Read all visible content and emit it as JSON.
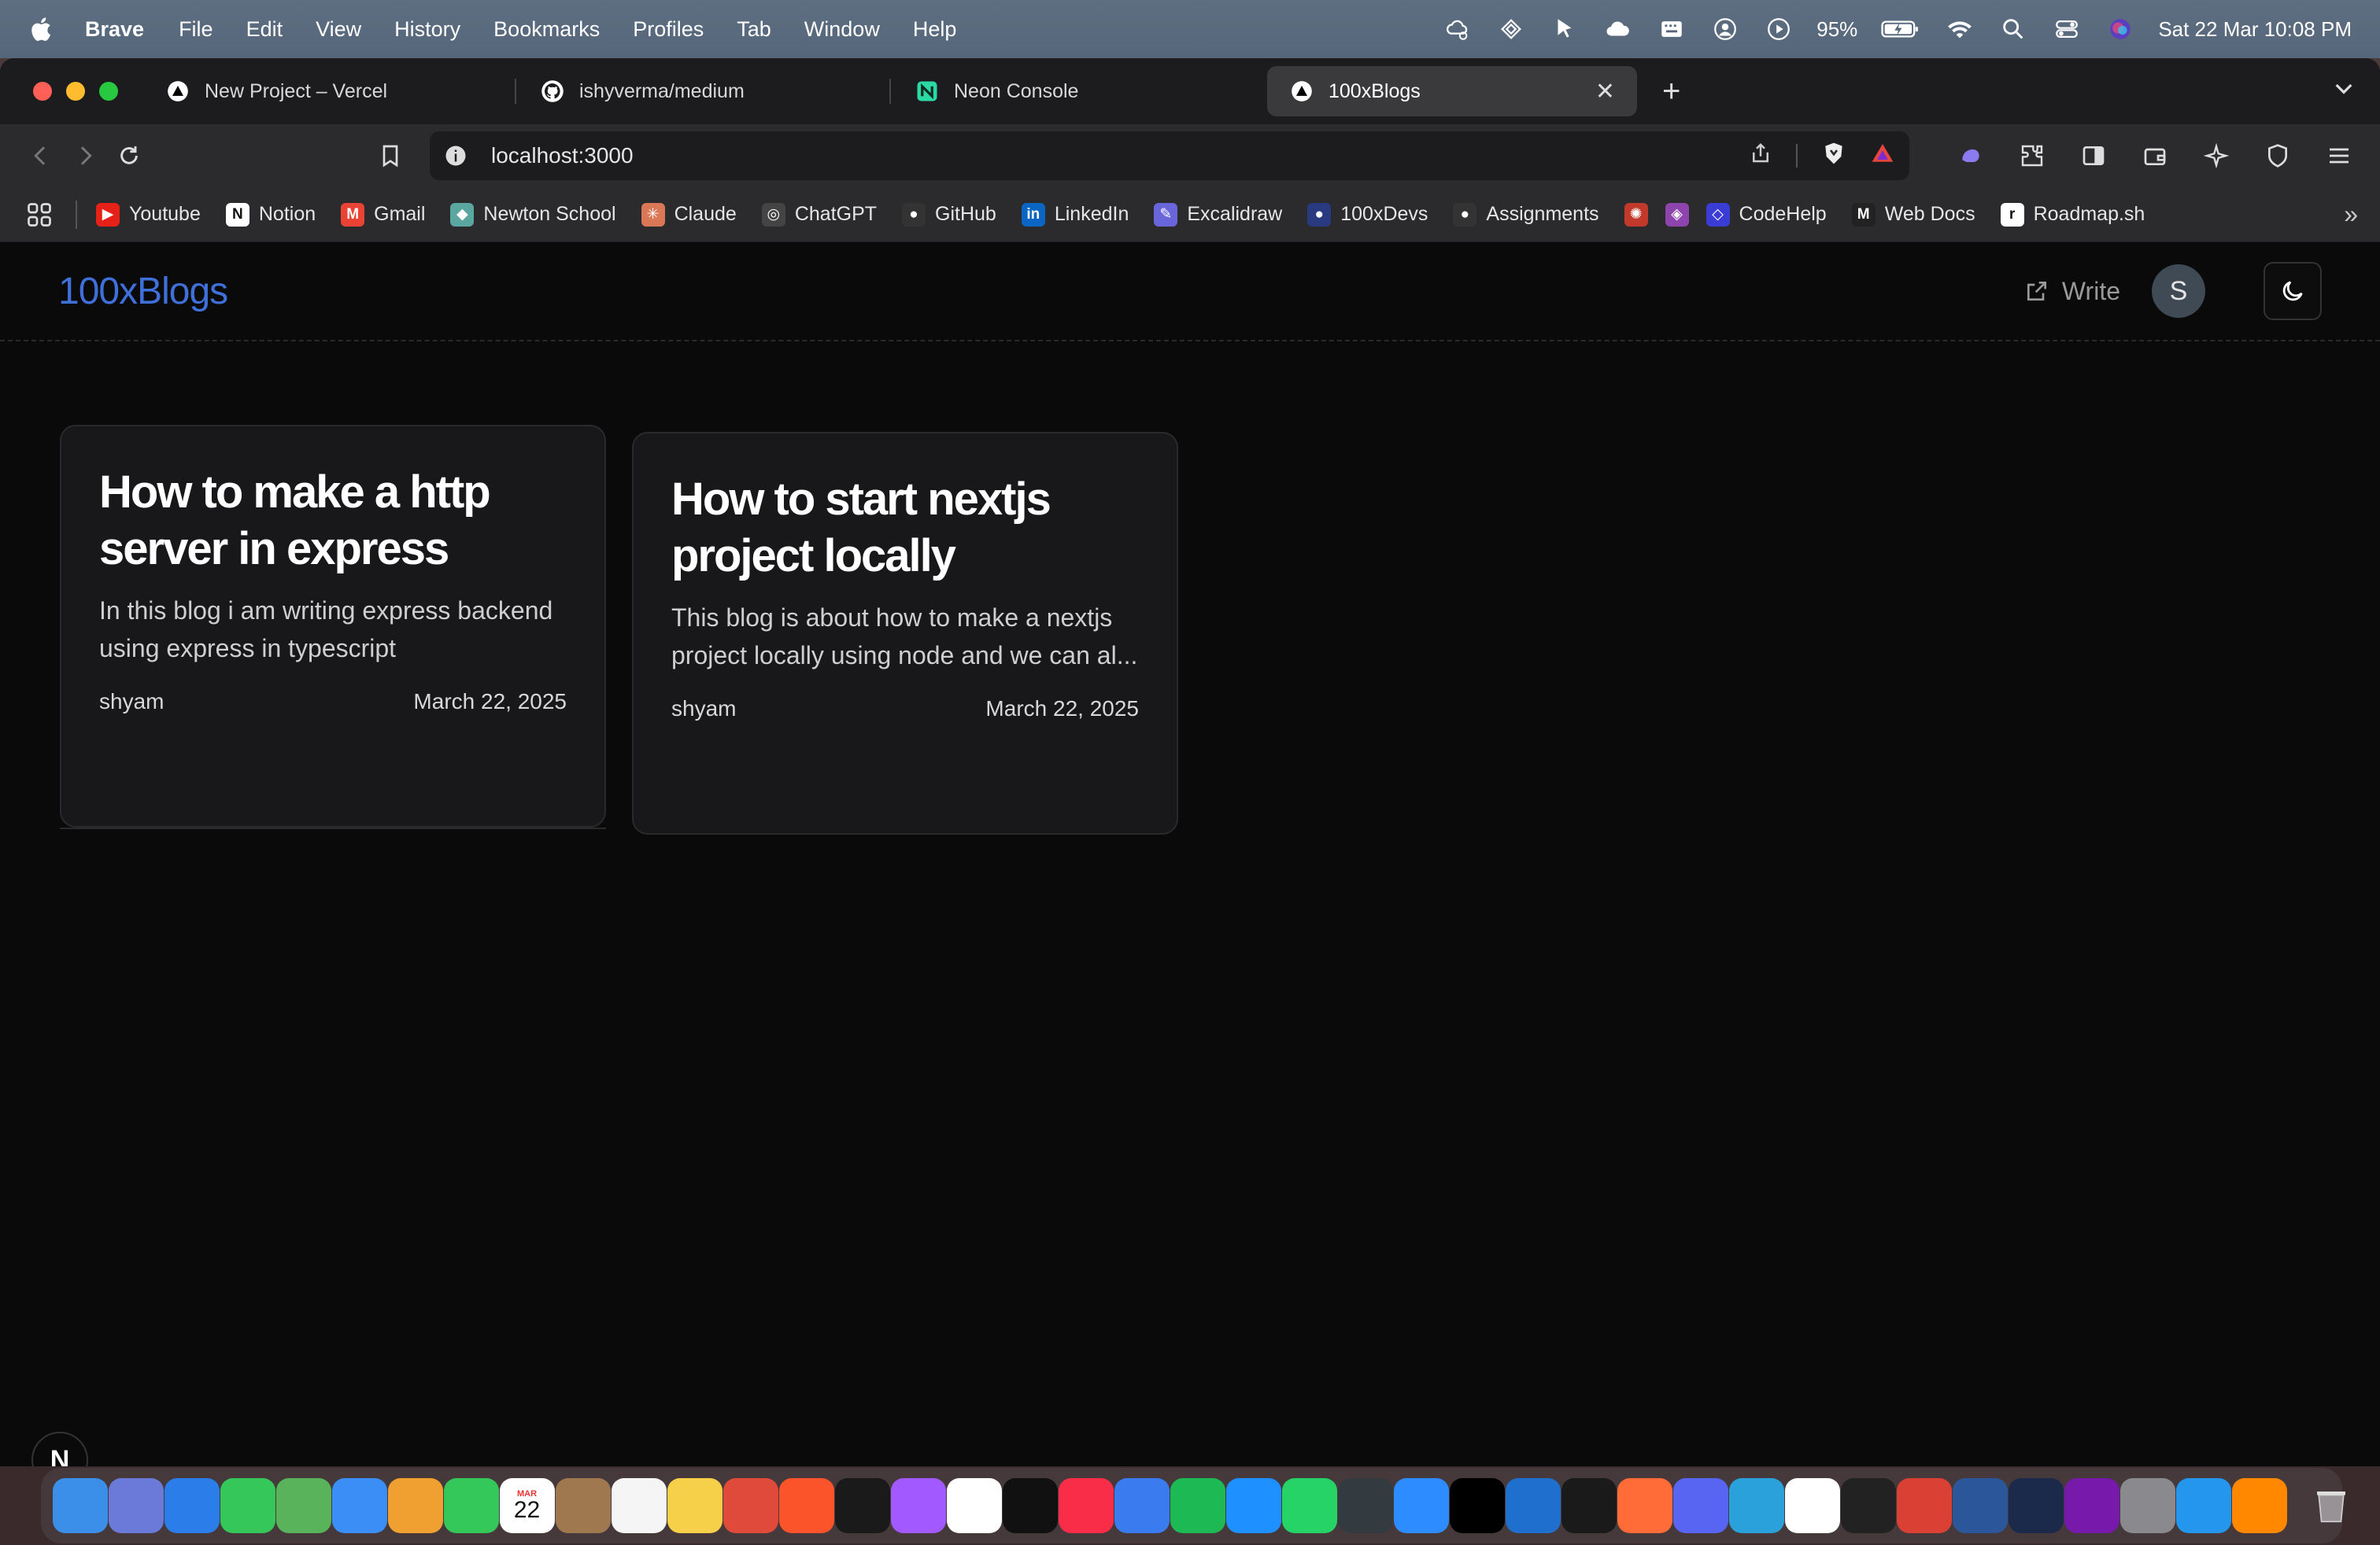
{
  "menubar": {
    "app_name": "Brave",
    "menus": [
      "File",
      "Edit",
      "View",
      "History",
      "Bookmarks",
      "Profiles",
      "Tab",
      "Window",
      "Help"
    ],
    "battery": "95%",
    "datetime": "Sat 22 Mar  10:08 PM"
  },
  "browser": {
    "tabs": [
      {
        "title": "New Project – Vercel",
        "icon": "vercel-icon"
      },
      {
        "title": "ishyverma/medium",
        "icon": "github-icon"
      },
      {
        "title": "Neon Console",
        "icon": "neon-icon"
      },
      {
        "title": "100xBlogs",
        "icon": "vercel-icon",
        "active": true
      }
    ],
    "url": "localhost:3000",
    "bookmarks": [
      {
        "label": "Youtube",
        "color": "#e62117",
        "glyph": "▶"
      },
      {
        "label": "Notion",
        "color": "#ffffff",
        "glyph": "N"
      },
      {
        "label": "Gmail",
        "color": "#ea4335",
        "glyph": "M"
      },
      {
        "label": "Newton School",
        "color": "#5aa6a0",
        "glyph": "◆"
      },
      {
        "label": "Claude",
        "color": "#d97757",
        "glyph": "✳"
      },
      {
        "label": "ChatGPT",
        "color": "#444444",
        "glyph": "◎"
      },
      {
        "label": "GitHub",
        "color": "#333333",
        "glyph": "●"
      },
      {
        "label": "LinkedIn",
        "color": "#0a66c2",
        "glyph": "in"
      },
      {
        "label": "Excalidraw",
        "color": "#6965db",
        "glyph": "✎"
      },
      {
        "label": "100xDevs",
        "color": "#2a3a80",
        "glyph": "●"
      },
      {
        "label": "Assignments",
        "color": "#333333",
        "glyph": "●"
      },
      {
        "label": "",
        "color": "#c0392b",
        "glyph": "✺"
      },
      {
        "label": "",
        "color": "#8e44ad",
        "glyph": "◈"
      },
      {
        "label": "CodeHelp",
        "color": "#3b3bd6",
        "glyph": "◇"
      },
      {
        "label": "Web Docs",
        "color": "#222222",
        "glyph": "M"
      },
      {
        "label": "Roadmap.sh",
        "color": "#ffffff",
        "glyph": "r"
      }
    ]
  },
  "app": {
    "logo": "100xBlogs",
    "write_label": "Write",
    "avatar_initial": "S",
    "theme_icon": "moon-icon"
  },
  "posts": [
    {
      "title": "How to make a http server in express",
      "description": "In this blog i am writing express backend using express in typescript",
      "author": "shyam",
      "date": "March 22, 2025"
    },
    {
      "title": "How to start nextjs project locally",
      "description": "This blog is about how to make a nextjs project locally using node and we can al...",
      "author": "shyam",
      "date": "March 22, 2025"
    }
  ],
  "nextjs_badge": "N",
  "dock": {
    "calendar_month": "MAR",
    "calendar_day": "22",
    "apps": [
      {
        "name": "finder",
        "color": "#3b8fe8"
      },
      {
        "name": "launchpad",
        "color": "#6b7ad8"
      },
      {
        "name": "safari",
        "color": "#2b7de9"
      },
      {
        "name": "messages",
        "color": "#35c759"
      },
      {
        "name": "maps",
        "color": "#58b35a"
      },
      {
        "name": "mail",
        "color": "#3a8ef5"
      },
      {
        "name": "photos",
        "color": "#f0a030"
      },
      {
        "name": "facetime",
        "color": "#34c759"
      },
      {
        "name": "calendar",
        "color": "#ffffff"
      },
      {
        "name": "contacts",
        "color": "#a07850"
      },
      {
        "name": "reminders",
        "color": "#f5f5f5"
      },
      {
        "name": "notes",
        "color": "#f7d04a"
      },
      {
        "name": "chrome",
        "color": "#e04a3a"
      },
      {
        "name": "brave",
        "color": "#fb542b"
      },
      {
        "name": "screen-recorder",
        "color": "#1a1a1a"
      },
      {
        "name": "figma",
        "color": "#a259ff"
      },
      {
        "name": "freeform",
        "color": "#ffffff"
      },
      {
        "name": "apple-tv",
        "color": "#111111"
      },
      {
        "name": "music",
        "color": "#fa2d48"
      },
      {
        "name": "keynote",
        "color": "#3a7bf0"
      },
      {
        "name": "spotify",
        "color": "#1db954"
      },
      {
        "name": "app-store",
        "color": "#1e90ff"
      },
      {
        "name": "whatsapp",
        "color": "#25d366"
      },
      {
        "name": "mission-control",
        "color": "#333a40"
      },
      {
        "name": "zoom",
        "color": "#2d8cff"
      },
      {
        "name": "webstorm",
        "color": "#000000"
      },
      {
        "name": "vscode",
        "color": "#1f6fcf"
      },
      {
        "name": "cursor",
        "color": "#1a1a1a"
      },
      {
        "name": "postman",
        "color": "#ff6c37"
      },
      {
        "name": "discord",
        "color": "#5865f2"
      },
      {
        "name": "telegram",
        "color": "#2aa1da"
      },
      {
        "name": "notion",
        "color": "#ffffff"
      },
      {
        "name": "linear",
        "color": "#222222"
      },
      {
        "name": "todoist",
        "color": "#db4035"
      },
      {
        "name": "word",
        "color": "#2b579a"
      },
      {
        "name": "terminal",
        "color": "#1b2a4a"
      },
      {
        "name": "onenote",
        "color": "#7719aa"
      },
      {
        "name": "system-settings",
        "color": "#8a8a8e"
      },
      {
        "name": "docker",
        "color": "#2496ed"
      },
      {
        "name": "vlc",
        "color": "#ff8800"
      }
    ],
    "trash": "trash"
  }
}
